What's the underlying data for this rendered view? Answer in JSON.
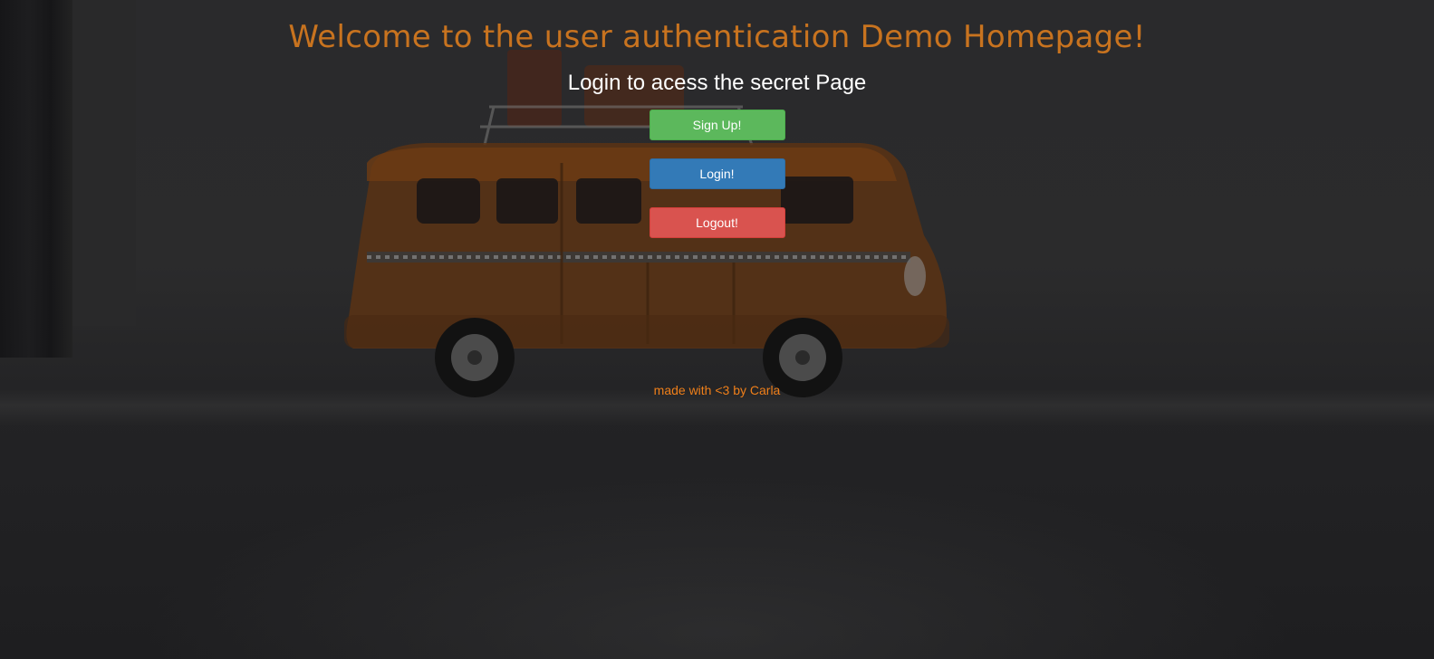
{
  "header": {
    "title": "Welcome to the user authentication Demo Homepage!",
    "subtitle": "Login to acess the secret Page"
  },
  "buttons": {
    "signup_label": "Sign Up!",
    "login_label": "Login!",
    "logout_label": "Logout!"
  },
  "footer": {
    "text": "made with <3 by Carla"
  },
  "colors": {
    "title": "#c8731f",
    "signup": "#5cb85c",
    "login": "#337ab7",
    "logout": "#d9534f",
    "footer": "#ef7f1a"
  },
  "background": {
    "subject-icon": "toy-vw-bus-photo"
  }
}
